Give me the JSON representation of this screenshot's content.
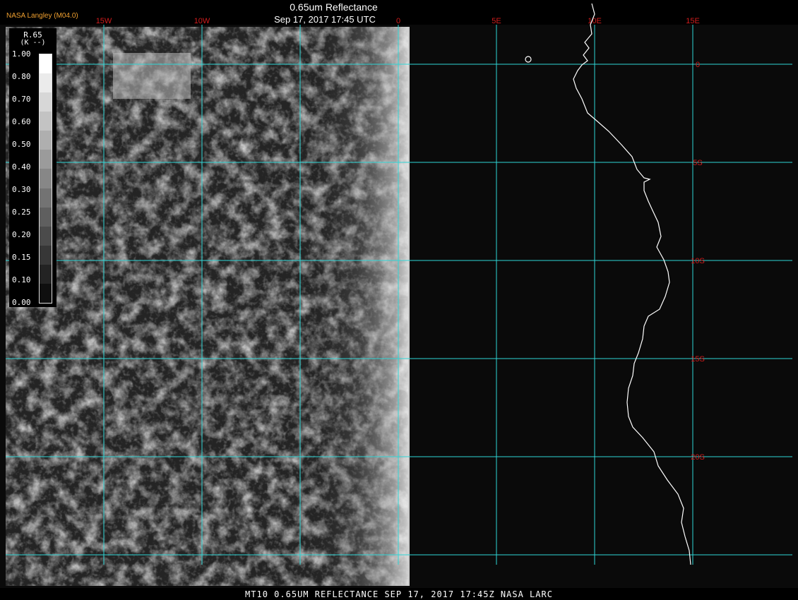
{
  "header": {
    "credit": "NASA Langley (M04.0)",
    "title": "0.65um Reflectance",
    "time": "Sep 17, 2017 17:45 UTC"
  },
  "footer": {
    "label": "MT10  0.65UM REFLECTANCE   SEP 17, 2017 17:45Z   NASA LARC"
  },
  "colors": {
    "grid": "#2fd6d6",
    "grid_label": "#d01c1c",
    "header_credit": "#f0a030",
    "header_text": "#ffffff",
    "coastline": "#ffffff",
    "background": "#0a0a0a"
  },
  "map": {
    "type": "satellite image with lat/lon grid",
    "longitude_labels": [
      "15W",
      "10W",
      "0",
      "5E",
      "10E",
      "15E"
    ],
    "latitude_labels": [
      "0",
      "5S",
      "10S",
      "15S",
      "20S"
    ],
    "longitude_lines": [
      -15,
      -10,
      -5,
      0,
      5,
      10,
      15
    ],
    "latitude_lines": [
      0,
      -5,
      -10,
      -15,
      -20,
      -25
    ],
    "lon_range": [
      -20,
      20
    ],
    "lat_range": [
      -26,
      2
    ]
  },
  "legend": {
    "header": "R.65",
    "unit": "(K  --)",
    "ticks": [
      "1.00",
      "0.80",
      "0.70",
      "0.60",
      "0.50",
      "0.40",
      "0.30",
      "0.25",
      "0.20",
      "0.15",
      "0.10",
      "0.00"
    ],
    "swatch_colors": [
      "#ffffff",
      "#ebebeb",
      "#d7d7d7",
      "#c3c3c3",
      "#afafaf",
      "#9b9b9b",
      "#878787",
      "#737373",
      "#5f5f5f",
      "#4b4b4b",
      "#373737",
      "#232323",
      "#0f0f0f"
    ]
  }
}
